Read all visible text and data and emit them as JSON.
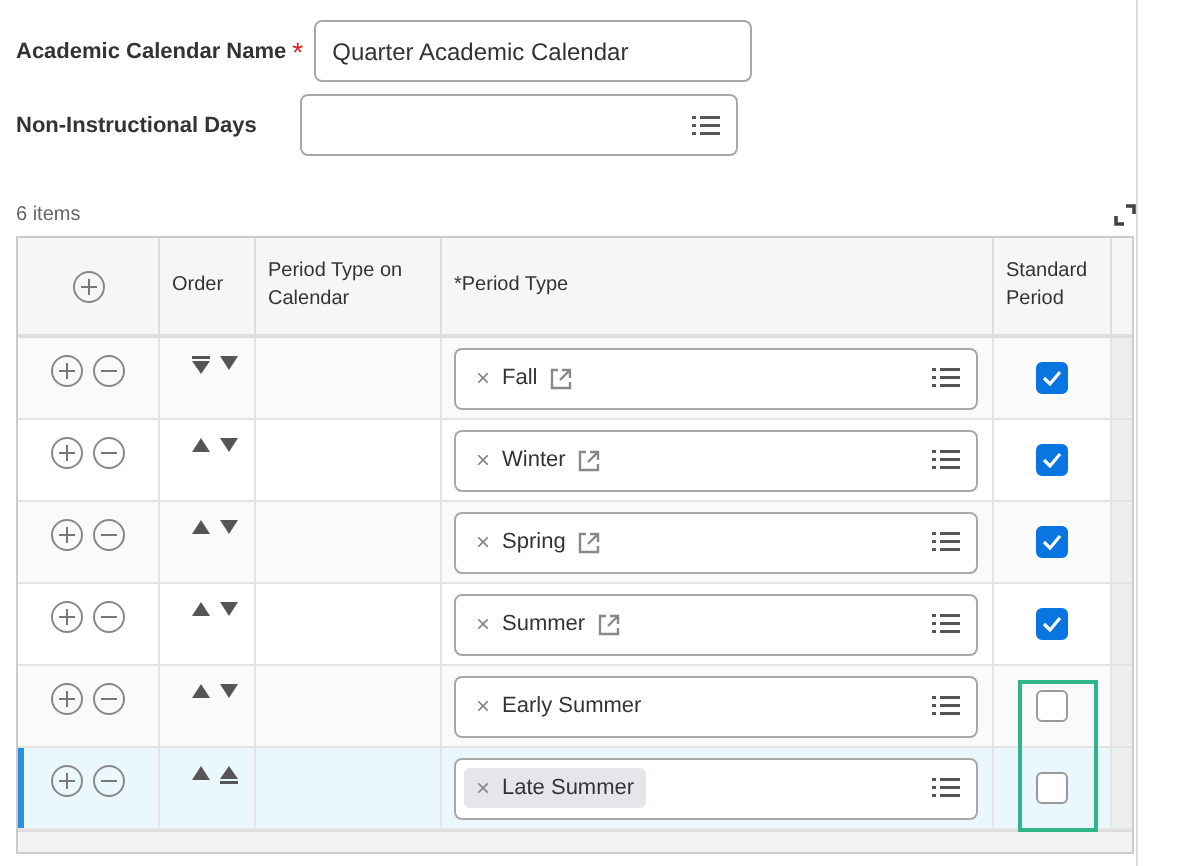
{
  "fields": [
    {
      "label": "Academic Calendar Name",
      "required_mark": "*",
      "value": "Quarter Academic Calendar",
      "kind": "text"
    },
    {
      "label": "Non-Instructional Days",
      "kind": "prompt"
    }
  ],
  "item_count": "6 items",
  "table": {
    "columns": [
      "Order",
      "Period Type on Calendar",
      "*Period Type",
      "Standard Period"
    ],
    "rows": [
      {
        "remove": "×",
        "period_type": "Fall",
        "link": true,
        "checked": true,
        "selected": false,
        "tag_focused": false,
        "outlined": false
      },
      {
        "remove": "×",
        "period_type": "Winter",
        "link": true,
        "checked": true,
        "selected": false,
        "tag_focused": false,
        "outlined": false
      },
      {
        "remove": "×",
        "period_type": "Spring",
        "link": true,
        "checked": true,
        "selected": false,
        "tag_focused": false,
        "outlined": false
      },
      {
        "remove": "×",
        "period_type": "Summer",
        "link": true,
        "checked": true,
        "selected": false,
        "tag_focused": false,
        "outlined": false
      },
      {
        "remove": "×",
        "period_type": "Early Summer",
        "link": false,
        "checked": false,
        "selected": false,
        "tag_focused": false,
        "outlined": true
      },
      {
        "remove": "×",
        "period_type": "Late Summer",
        "link": false,
        "checked": false,
        "selected": true,
        "tag_focused": true,
        "outlined": true
      }
    ]
  }
}
